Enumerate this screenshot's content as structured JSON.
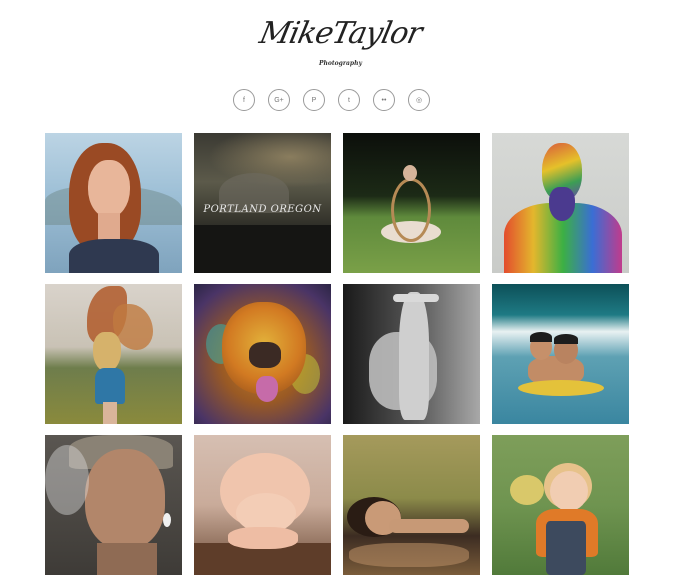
{
  "header": {
    "logo": "MikeTaylor",
    "tagline": "Photography"
  },
  "social": [
    {
      "name": "facebook",
      "glyph": "f"
    },
    {
      "name": "google-plus",
      "glyph": "G+"
    },
    {
      "name": "pinterest",
      "glyph": "P"
    },
    {
      "name": "twitter",
      "glyph": "t"
    },
    {
      "name": "flickr",
      "glyph": "••"
    },
    {
      "name": "dribbble",
      "glyph": "◎"
    }
  ],
  "gallery": {
    "tiles": [
      {
        "subject": "Portrait of a red-haired woman"
      },
      {
        "subject": "City skyline at dusk",
        "caption": "PORTLAND OREGON"
      },
      {
        "subject": "Woman with hoop on grass"
      },
      {
        "subject": "Bearded man covered in colorful paint"
      },
      {
        "subject": "Girl with butterfly wings in a field"
      },
      {
        "subject": "Dog with painted face"
      },
      {
        "subject": "Black and white dancers"
      },
      {
        "subject": "Two boys in the sea"
      },
      {
        "subject": "Old woman smoking"
      },
      {
        "subject": "Sleeping baby"
      },
      {
        "subject": "Woman lying by the water"
      },
      {
        "subject": "Child holding flowers"
      }
    ]
  }
}
